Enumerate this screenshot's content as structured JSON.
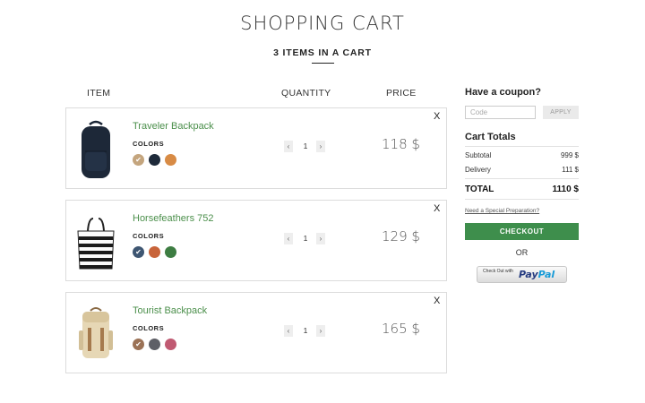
{
  "header": {
    "title": "SHOPPING CART",
    "subtitle": "3 ITEMS IN A CART"
  },
  "columns": {
    "item": "ITEM",
    "quantity": "QUANTITY",
    "price": "PRICE"
  },
  "items": [
    {
      "name": "Traveler Backpack",
      "colors_label": "COLORS",
      "swatches": [
        "#c4a57e",
        "#1e2a3a",
        "#d88b45"
      ],
      "selected_swatch": 0,
      "quantity": "1",
      "price": "118 $",
      "remove": "X",
      "qty_minus": "‹",
      "qty_plus": "›"
    },
    {
      "name": "Horsefeathers 752",
      "colors_label": "COLORS",
      "swatches": [
        "#3e5672",
        "#c8643a",
        "#3d7d42"
      ],
      "selected_swatch": 0,
      "quantity": "1",
      "price": "129 $",
      "remove": "X",
      "qty_minus": "‹",
      "qty_plus": "›"
    },
    {
      "name": "Tourist Backpack",
      "colors_label": "COLORS",
      "swatches": [
        "#9b7256",
        "#5e5f66",
        "#c05a72"
      ],
      "selected_swatch": 0,
      "quantity": "1",
      "price": "165 $",
      "remove": "X",
      "qty_minus": "‹",
      "qty_plus": "›"
    }
  ],
  "coupon": {
    "heading": "Have a coupon?",
    "placeholder": "Code",
    "apply_label": "APPLY"
  },
  "totals": {
    "heading": "Cart Totals",
    "subtotal_label": "Subtotal",
    "subtotal_value": "999 $",
    "delivery_label": "Delivery",
    "delivery_value": "111 $",
    "total_label": "TOTAL",
    "total_value": "1110 $",
    "special_link": "Need a Special Preparation?",
    "checkout_label": "CHECKOUT",
    "or_label": "OR"
  },
  "paypal": {
    "small_text": "Check Out with",
    "logo_pay": "Pay",
    "logo_pal": "Pal"
  },
  "colors": {
    "accent_green": "#3e8e4c",
    "product_name": "#4b8f4b"
  }
}
